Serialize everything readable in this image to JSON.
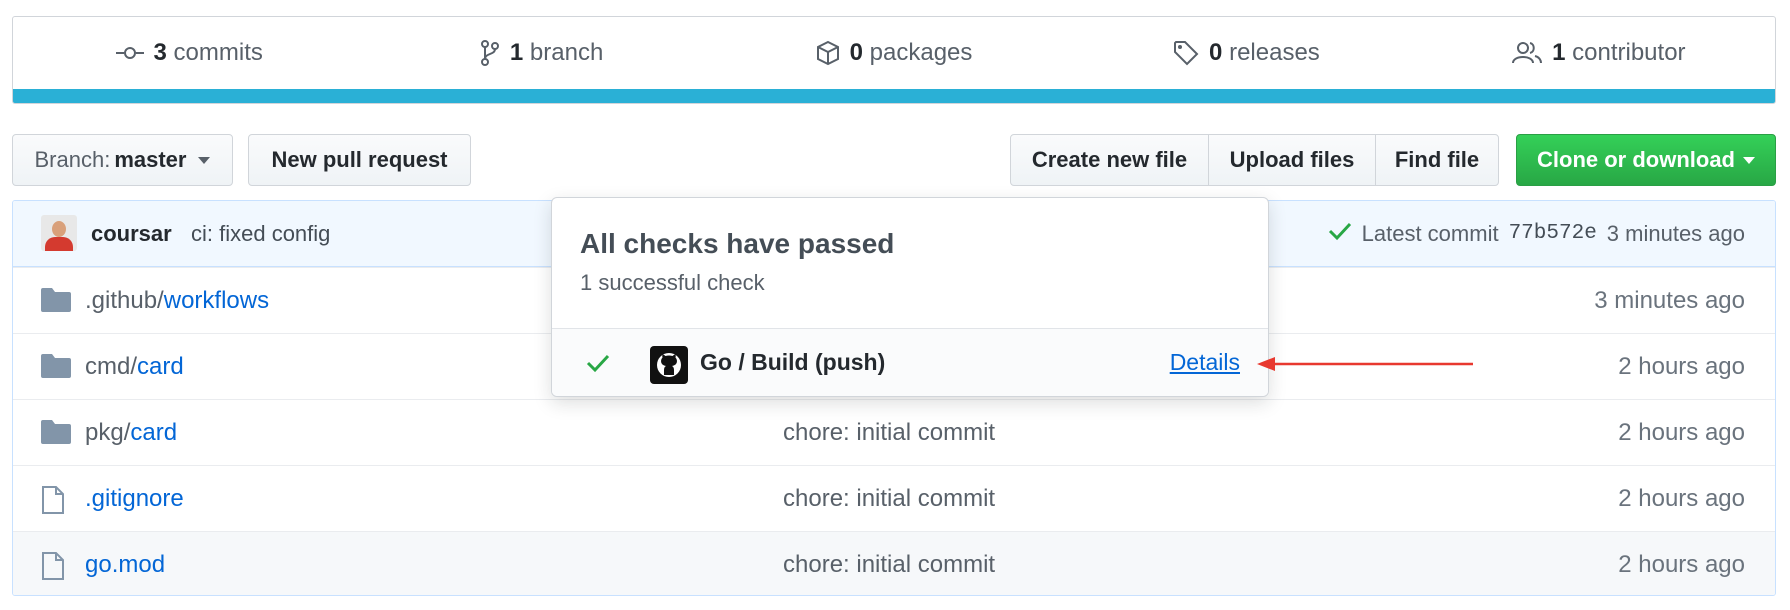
{
  "summary": {
    "commits": {
      "count": "3",
      "label": "commits",
      "icon": "commit-icon"
    },
    "branches": {
      "count": "1",
      "label": "branch",
      "icon": "branch-icon"
    },
    "packages": {
      "count": "0",
      "label": "packages",
      "icon": "package-icon"
    },
    "releases": {
      "count": "0",
      "label": "releases",
      "icon": "tag-icon"
    },
    "contributors": {
      "count": "1",
      "label": "contributor",
      "icon": "people-icon"
    },
    "language_bar_color": "#2ab0d6"
  },
  "toolbar": {
    "branch_prefix": "Branch:",
    "branch_name": "master",
    "new_pr": "New pull request",
    "create_file": "Create new file",
    "upload_files": "Upload files",
    "find_file": "Find file",
    "clone": "Clone or download"
  },
  "latest_commit": {
    "author": "coursar",
    "message": "ci: fixed config",
    "prefix": "Latest commit",
    "sha": "77b572e",
    "age": "3 minutes ago"
  },
  "files": [
    {
      "type": "dir",
      "prefix": ".github/",
      "link": "workflows",
      "message": "",
      "age": "3 minutes ago"
    },
    {
      "type": "dir",
      "prefix": "cmd/",
      "link": "card",
      "message": "",
      "age": "2 hours ago"
    },
    {
      "type": "dir",
      "prefix": "pkg/",
      "link": "card",
      "message": "chore: initial commit",
      "age": "2 hours ago"
    },
    {
      "type": "file",
      "prefix": "",
      "link": ".gitignore",
      "message": "chore: initial commit",
      "age": "2 hours ago"
    },
    {
      "type": "file",
      "prefix": "",
      "link": "go.mod",
      "message": "chore: initial commit",
      "age": "2 hours ago"
    }
  ],
  "checks_popover": {
    "title": "All checks have passed",
    "subtitle": "1 successful check",
    "check": {
      "name": "Go / Build (push)",
      "status": "success",
      "link": "Details",
      "icon": "github-icon"
    }
  },
  "colors": {
    "link": "#0366d6",
    "success": "#28a745",
    "annotation_arrow": "#e8382f"
  }
}
